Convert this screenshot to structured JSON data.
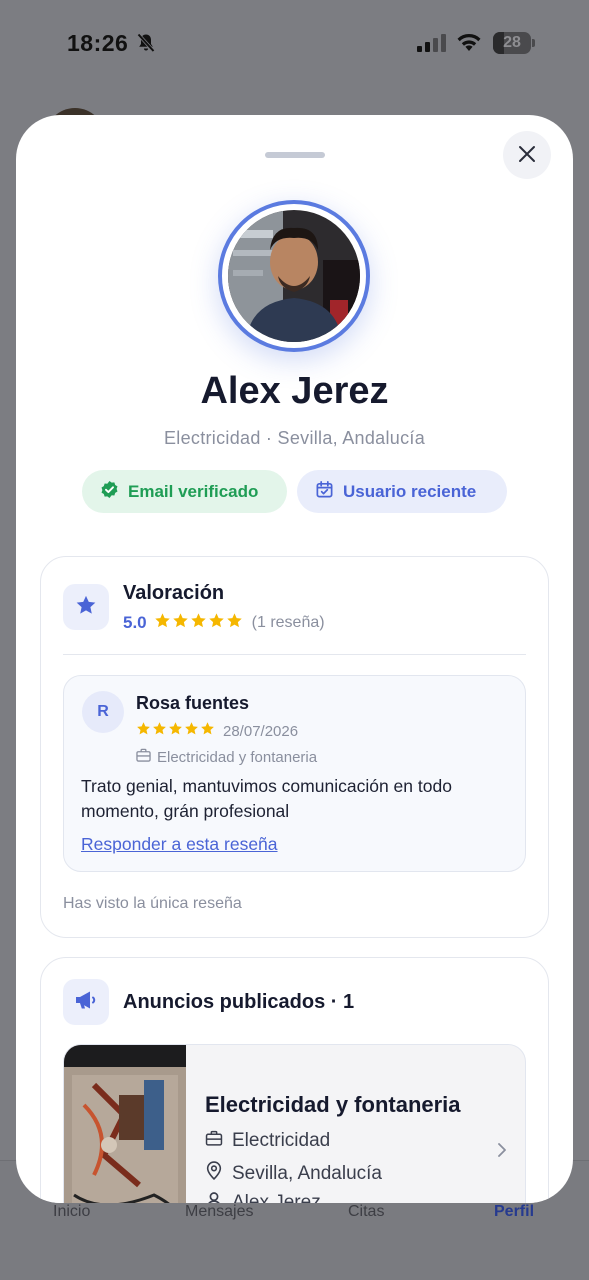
{
  "status_bar": {
    "time": "18:26",
    "battery": "28",
    "battery_level": 0.28
  },
  "bottom_nav": {
    "items": [
      "Inicio",
      "Mensajes",
      "Citas",
      "Perfil"
    ],
    "active": "Perfil"
  },
  "profile": {
    "name": "Alex Jerez",
    "subtitle": "Electricidad · Sevilla, Andalucía",
    "badges": {
      "email": "Email verificado",
      "recent": "Usuario reciente"
    }
  },
  "rating": {
    "title": "Valoración",
    "score": "5.0",
    "stars": 5,
    "count": "(1 reseña)",
    "review": {
      "initial": "R",
      "author": "Rosa fuentes",
      "stars": 5,
      "date": "28/07/2026",
      "category": "Electricidad y fontaneria",
      "text": "Trato genial, mantuvimos comunicación en todo momento, grán profesional",
      "reply": "Responder a esta reseña"
    },
    "seen_all": "Has visto la única reseña"
  },
  "ads": {
    "title": "Anuncios publicados · 1",
    "items": [
      {
        "title": "Electricidad y fontaneria",
        "category": "Electricidad",
        "location": "Sevilla, Andalucía",
        "author": "Alex Jerez"
      }
    ]
  },
  "colors": {
    "accent": "#4a64d6",
    "star": "#f5b700",
    "verified": "#1f9d55"
  }
}
